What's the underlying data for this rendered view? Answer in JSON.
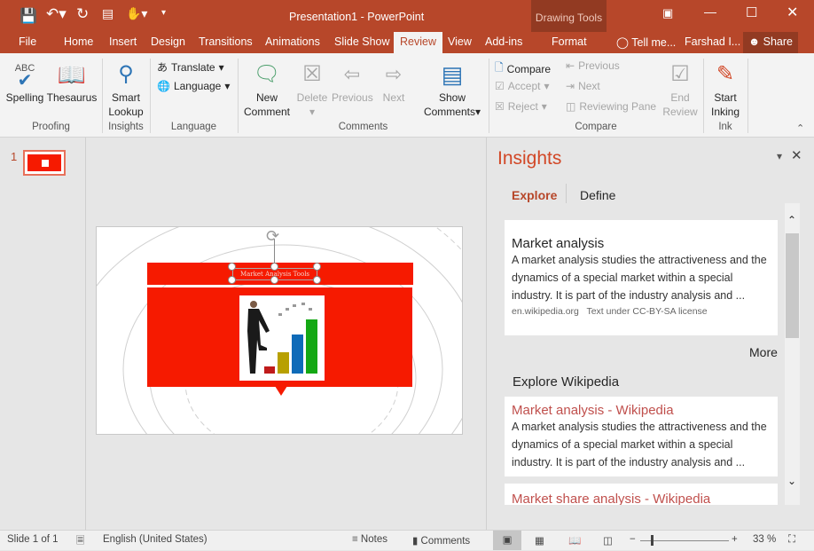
{
  "window": {
    "title": "Presentation1 - PowerPoint",
    "context_group": "Drawing Tools",
    "accent": "#b7472a"
  },
  "tabs": [
    {
      "label": "File"
    },
    {
      "label": "Home"
    },
    {
      "label": "Insert"
    },
    {
      "label": "Design"
    },
    {
      "label": "Transitions"
    },
    {
      "label": "Animations"
    },
    {
      "label": "Slide Show"
    },
    {
      "label": "Review"
    },
    {
      "label": "View"
    },
    {
      "label": "Add-ins"
    },
    {
      "label": "Format"
    }
  ],
  "tell_me": "Tell me...",
  "user": "Farshad I...",
  "share": "Share",
  "ribbon": {
    "proofing": {
      "label": "Proofing",
      "spelling": "Spelling",
      "thesaurus": "Thesaurus"
    },
    "insights": {
      "label": "Insights",
      "smart_lookup_1": "Smart",
      "smart_lookup_2": "Lookup"
    },
    "language": {
      "label": "Language",
      "translate": "Translate",
      "language": "Language"
    },
    "comments": {
      "label": "Comments",
      "new_1": "New",
      "new_2": "Comment",
      "delete": "Delete",
      "previous": "Previous",
      "next": "Next",
      "show_1": "Show",
      "show_2": "Comments"
    },
    "compare": {
      "label": "Compare",
      "compare": "Compare",
      "accept": "Accept",
      "reject": "Reject",
      "previous": "Previous",
      "next": "Next",
      "reviewing_pane": "Reviewing Pane",
      "end_1": "End",
      "end_2": "Review"
    },
    "ink": {
      "label": "Ink",
      "start_1": "Start",
      "start_2": "Inking"
    }
  },
  "thumbnails": [
    {
      "number": "1"
    }
  ],
  "slide": {
    "title_text": "Market Analysis Tools",
    "fill": "#f61a00"
  },
  "insights_pane": {
    "title": "Insights",
    "tabs": [
      "Explore",
      "Define"
    ],
    "top_card": {
      "title": "Market analysis",
      "text": "A market analysis studies the attractiveness and the dynamics of a special market within a special industry. It is part of the industry analysis and ...",
      "source": "en.wikipedia.org",
      "license": "Text under CC-BY-SA license"
    },
    "more": "More",
    "section": "Explore Wikipedia",
    "results": [
      {
        "title": "Market analysis - Wikipedia",
        "text": "A market analysis studies the attractiveness and the dynamics of a special market within a special industry. It is part of the industry analysis and ..."
      },
      {
        "title": "Market share analysis - Wikipedia"
      }
    ]
  },
  "status": {
    "slide": "Slide 1 of 1",
    "language": "English (United States)",
    "notes": "Notes",
    "comments": "Comments",
    "zoom": "33 %",
    "zoom_percent": 33
  }
}
